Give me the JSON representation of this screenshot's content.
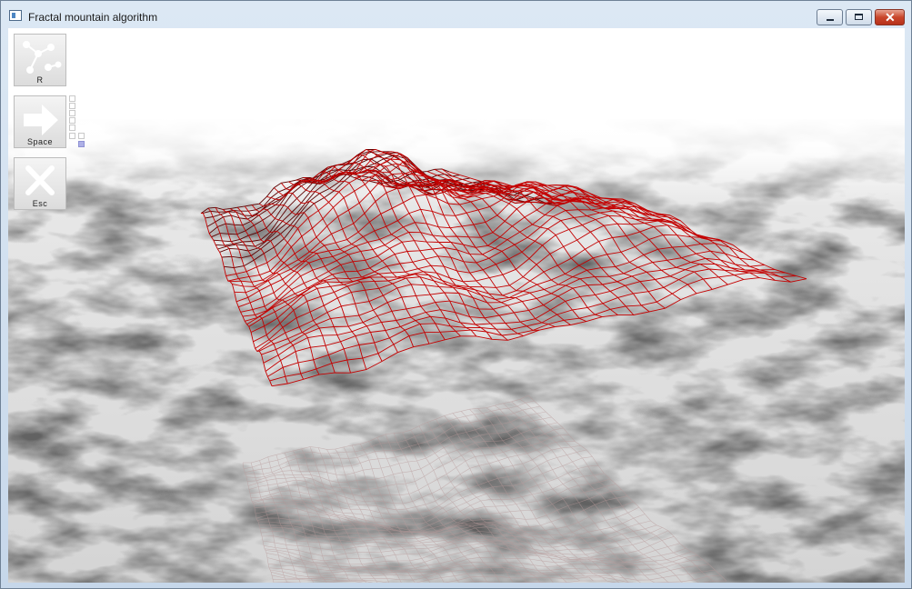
{
  "window": {
    "title": "Fractal mountain algorithm"
  },
  "toolbar": {
    "buttons": [
      {
        "key_label": "R",
        "icon": "scatter-points-icon"
      },
      {
        "key_label": "Space",
        "icon": "arrow-right-icon"
      },
      {
        "key_label": "Esc",
        "icon": "close-x-icon"
      }
    ],
    "iteration_levels": {
      "total": 7,
      "current": 7
    }
  },
  "colors": {
    "mesh": "#c40000",
    "mesh_dark": "#5a0000",
    "reflection": "#b89a9a"
  }
}
